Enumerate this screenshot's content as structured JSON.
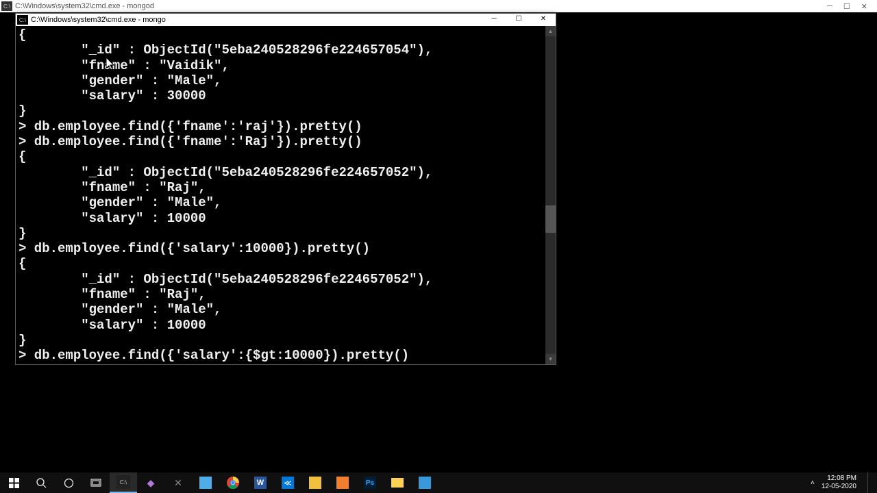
{
  "bg_window": {
    "title": "C:\\Windows\\system32\\cmd.exe - mongod"
  },
  "fg_window": {
    "title": "C:\\Windows\\system32\\cmd.exe - mongo"
  },
  "console_text": "{\n        \"_id\" : ObjectId(\"5eba240528296fe224657054\"),\n        \"fname\" : \"Vaidik\",\n        \"gender\" : \"Male\",\n        \"salary\" : 30000\n}\n> db.employee.find({'fname':'raj'}).pretty()\n> db.employee.find({'fname':'Raj'}).pretty()\n{\n        \"_id\" : ObjectId(\"5eba240528296fe224657052\"),\n        \"fname\" : \"Raj\",\n        \"gender\" : \"Male\",\n        \"salary\" : 10000\n}\n> db.employee.find({'salary':10000}).pretty()\n{\n        \"_id\" : ObjectId(\"5eba240528296fe224657052\"),\n        \"fname\" : \"Raj\",\n        \"gender\" : \"Male\",\n        \"salary\" : 10000\n}\n> db.employee.find({'salary':{$gt:10000}).pretty()",
  "taskbar": {
    "time": "12:08 PM",
    "date": "12-05-2020"
  }
}
